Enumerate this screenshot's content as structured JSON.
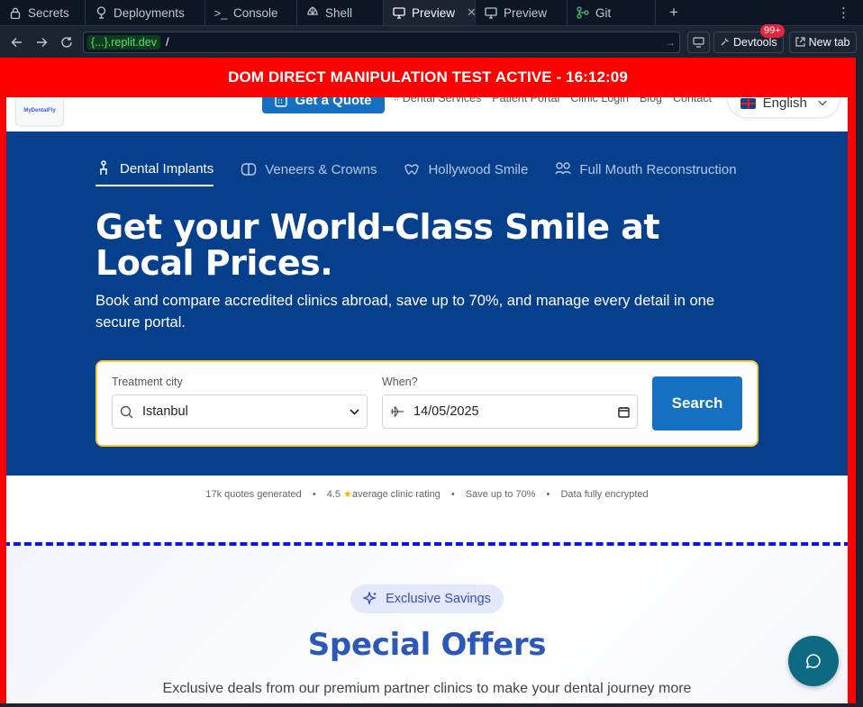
{
  "tabs": [
    {
      "label": "Secrets",
      "icon": "lock-icon"
    },
    {
      "label": "Deployments",
      "icon": "deployments-icon"
    },
    {
      "label": "Console",
      "icon": "terminal-icon"
    },
    {
      "label": "Shell",
      "icon": "shell-icon"
    },
    {
      "label": "Preview",
      "icon": "monitor-icon",
      "active": true
    },
    {
      "label": "Preview",
      "icon": "monitor-icon"
    },
    {
      "label": "Git",
      "icon": "git-icon"
    }
  ],
  "urlbar": {
    "domain": "{...}.replit.dev",
    "path": "/",
    "devtools_label": "Devtools",
    "devtools_badge": "99+",
    "newtab_label": "New tab"
  },
  "banner": {
    "text": "DOM DIRECT MANIPULATION TEST ACTIVE - 16:12:09",
    "color": "#ff0000"
  },
  "site_header": {
    "logo_text": "MyDentalFly",
    "quote_button": "Get a Quote",
    "nav": [
      "Dental Services",
      "Patient Portal",
      "Clinic Login",
      "Blog",
      "Contact"
    ],
    "language": "English"
  },
  "hero": {
    "categories": [
      {
        "label": "Dental Implants",
        "active": true,
        "icon": "implant-icon"
      },
      {
        "label": "Veneers & Crowns",
        "active": false,
        "icon": "veneer-icon"
      },
      {
        "label": "Hollywood Smile",
        "active": false,
        "icon": "smile-icon"
      },
      {
        "label": "Full Mouth Reconstruction",
        "active": false,
        "icon": "people-icon"
      }
    ],
    "title": "Get your World-Class Smile at Local Prices.",
    "subtitle": "Book and compare accredited clinics abroad, save up to 70%, and manage every detail in one secure portal.",
    "background": "#063f8c"
  },
  "search": {
    "city_label": "Treatment city",
    "city_value": "Istanbul",
    "date_label": "When?",
    "date_value": "14/05/2025",
    "button": "Search",
    "accent": "#1670c2"
  },
  "stats": {
    "quotes": "17k quotes generated",
    "rating_value": "4.5",
    "rating_label": "average clinic rating",
    "savings": "Save up to 70%",
    "security": "Data fully encrypted"
  },
  "offers": {
    "pill": "Exclusive Savings",
    "title": "Special Offers",
    "description": "Exclusive deals from our premium partner clinics to make your dental journey more"
  }
}
